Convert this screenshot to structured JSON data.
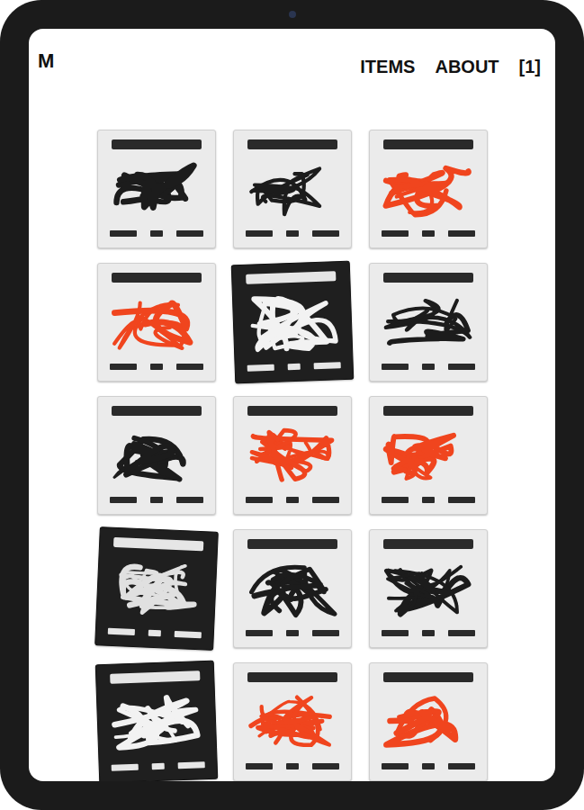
{
  "header": {
    "logo": "M",
    "nav": [
      {
        "label": "ITEMS"
      },
      {
        "label": "ABOUT"
      },
      {
        "label": "[1]"
      }
    ]
  },
  "items": [
    {
      "kind": "light",
      "color": "#1c1c1c"
    },
    {
      "kind": "light",
      "color": "#1c1c1c"
    },
    {
      "kind": "light",
      "color": "#f0451e"
    },
    {
      "kind": "light",
      "color": "#f0451e"
    },
    {
      "kind": "dark",
      "color": "#f2f2f2"
    },
    {
      "kind": "light",
      "color": "#1c1c1c"
    },
    {
      "kind": "light",
      "color": "#1c1c1c"
    },
    {
      "kind": "light",
      "color": "#f0451e"
    },
    {
      "kind": "light",
      "color": "#f0451e"
    },
    {
      "kind": "dark",
      "color": "#e0e0e0"
    },
    {
      "kind": "light",
      "color": "#1c1c1c"
    },
    {
      "kind": "light",
      "color": "#1c1c1c"
    },
    {
      "kind": "dark",
      "color": "#f2f2f2"
    },
    {
      "kind": "light",
      "color": "#f0451e"
    },
    {
      "kind": "light",
      "color": "#f0451e"
    }
  ]
}
